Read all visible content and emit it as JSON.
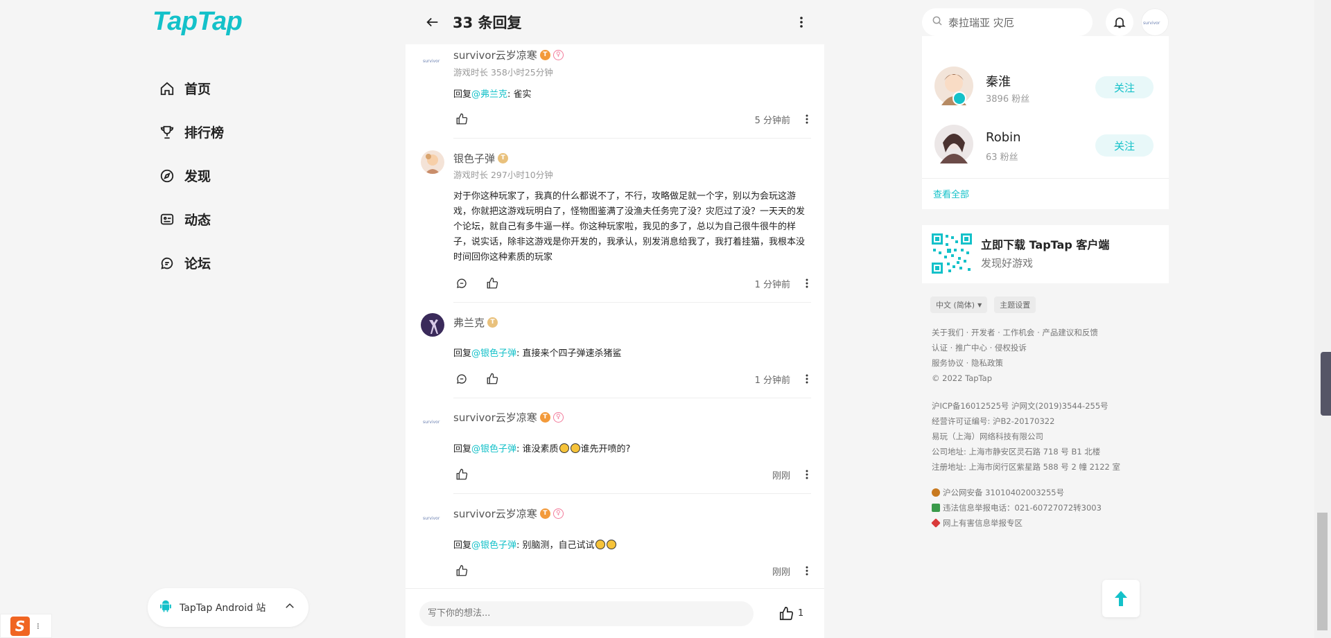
{
  "brand": {
    "logo_text": "TapTap",
    "accent": "#14c1c9"
  },
  "nav": [
    {
      "label": "首页",
      "icon": "home-icon"
    },
    {
      "label": "排行榜",
      "icon": "trophy-icon"
    },
    {
      "label": "发现",
      "icon": "discover-icon"
    },
    {
      "label": "动态",
      "icon": "feed-icon"
    },
    {
      "label": "论坛",
      "icon": "forum-icon"
    }
  ],
  "android_site": {
    "label": "TapTap Android 站"
  },
  "header": {
    "title": "33 条回复"
  },
  "replies": [
    {
      "user": "survivor云岁凉寒",
      "playtime": "游戏时长 358小时25分钟",
      "prefix": "回复",
      "mention": "@弗兰克",
      "text": ": 雀实",
      "time": "5 分钟前"
    },
    {
      "user": "银色子弹",
      "playtime": "游戏时长 297小时10分钟",
      "text": "对于你这种玩家了，我真的什么都说不了，不行，攻略做足就一个字，别以为会玩这游戏，你就把这游戏玩明白了，怪物图鉴满了没渔夫任务完了没？灾厄过了没？一天天的发个论坛，就自己有多牛逼一样。你这种玩家啦，我见的多了，总以为自己很牛很牛的样子，说实话，除非这游戏是你开发的，我承认，别发消息给我了，我打着挂猫，我根本没时间回你这种素质的玩家",
      "time": "1 分钟前"
    },
    {
      "user": "弗兰克",
      "prefix": "回复",
      "mention": "@银色子弹",
      "text": ": 直接来个四子弹速杀猪鲨",
      "time": "1 分钟前"
    },
    {
      "user": "survivor云岁凉寒",
      "prefix": "回复",
      "mention": "@银色子弹",
      "text_a": ": 谁没素质",
      "text_b": "谁先开喷的?",
      "time": "刚刚"
    },
    {
      "user": "survivor云岁凉寒",
      "prefix": "回复",
      "mention": "@银色子弹",
      "text": ": 别脑测，自己试试",
      "time": "刚刚"
    }
  ],
  "composer": {
    "placeholder": "写下你的想法...",
    "like_count": "1"
  },
  "search": {
    "placeholder": "泰拉瑞亚 灾厄"
  },
  "follow": {
    "items": [
      {
        "name": "秦淮",
        "fans": "3896 粉丝",
        "button": "关注"
      },
      {
        "name": "Robin",
        "fans": "63 粉丝",
        "button": "关注"
      }
    ],
    "see_all": "查看全部"
  },
  "download": {
    "title": "立即下载 TapTap 客户端",
    "subtitle": "发现好游戏"
  },
  "footer": {
    "language": "中文 (简体)",
    "theme": "主题设置",
    "line1": "关于我们 · 开发者 · 工作机会 · 产品建议和反馈",
    "line2": "认证 · 推广中心 · 侵权投诉",
    "line3": "服务协议 · 隐私政策",
    "copyright": "© 2022 TapTap",
    "icp": "沪ICP备16012525号    沪网文(2019)3544-255号",
    "license": "经营许可证编号: 沪B2-20170322",
    "company": "易玩（上海）网络科技有限公司",
    "address1": "公司地址: 上海市静安区灵石路 718 号 B1 北楼",
    "address2": "注册地址: 上海市闵行区紫星路 588 号 2 幢 2122 室",
    "police": "沪公网安备 31010402003255号",
    "report": "违法信息举报电话：021-60727072转3003",
    "harmful": "网上有害信息举报专区"
  }
}
